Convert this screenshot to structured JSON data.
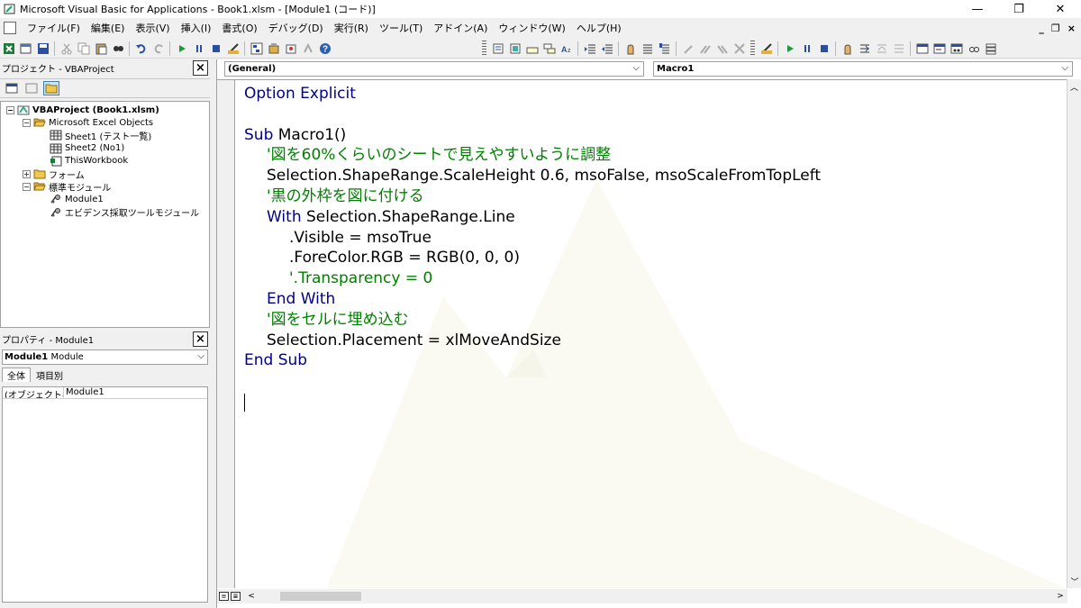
{
  "titlebar": {
    "title": "Microsoft Visual Basic for Applications - Book1.xlsm - [Module1 (コード)]",
    "minimize": "—",
    "restore": "❐",
    "close": "✕"
  },
  "menubar": {
    "items": [
      "ファイル(F)",
      "編集(E)",
      "表示(V)",
      "挿入(I)",
      "書式(O)",
      "デバッグ(D)",
      "実行(R)",
      "ツール(T)",
      "アドイン(A)",
      "ウィンドウ(W)",
      "ヘルプ(H)"
    ],
    "mdi_minimize": "_",
    "mdi_restore": "❐",
    "mdi_close": "×"
  },
  "project_panel": {
    "title": "プロジェクト - VBAProject",
    "close": "×",
    "tree": [
      {
        "label": "VBAProject (Book1.xlsm)",
        "level": 0,
        "expander": "−",
        "icon": "vba-project-icon",
        "bold": true
      },
      {
        "label": "Microsoft Excel Objects",
        "level": 1,
        "expander": "−",
        "icon": "folder-open-icon"
      },
      {
        "label": "Sheet1 (テスト一覧)",
        "level": 2,
        "expander": "",
        "icon": "sheet-icon"
      },
      {
        "label": "Sheet2 (No1)",
        "level": 2,
        "expander": "",
        "icon": "sheet-icon"
      },
      {
        "label": "ThisWorkbook",
        "level": 2,
        "expander": "",
        "icon": "workbook-icon"
      },
      {
        "label": "フォーム",
        "level": 1,
        "expander": "+",
        "icon": "folder-icon"
      },
      {
        "label": "標準モジュール",
        "level": 1,
        "expander": "−",
        "icon": "folder-open-icon"
      },
      {
        "label": "Module1",
        "level": 2,
        "expander": "",
        "icon": "module-icon"
      },
      {
        "label": "エビデンス採取ツールモジュール",
        "level": 2,
        "expander": "",
        "icon": "module-icon"
      }
    ]
  },
  "properties_panel": {
    "title": "プロパティ - Module1",
    "close": "×",
    "object_bold": "Module1",
    "object_type": "Module",
    "tab_all": "全体",
    "tab_category": "項目別",
    "rows": [
      {
        "key": "(オブジェクト名)",
        "value": "Module1"
      }
    ]
  },
  "code_window": {
    "object_combo": "(General)",
    "procedure_combo": "Macro1",
    "lines": [
      {
        "indent": 0,
        "parts": [
          {
            "t": "kw",
            "s": "Option Explicit"
          }
        ]
      },
      {
        "indent": 0,
        "parts": []
      },
      {
        "indent": 0,
        "parts": [
          {
            "t": "kw",
            "s": "Sub "
          },
          {
            "t": "tx",
            "s": "Macro1()"
          }
        ]
      },
      {
        "indent": 1,
        "parts": [
          {
            "t": "cm",
            "s": "'図を60%くらいのシートで見えやすいように調整"
          }
        ]
      },
      {
        "indent": 1,
        "parts": [
          {
            "t": "tx",
            "s": "Selection.ShapeRange.ScaleHeight 0.6, msoFalse, msoScaleFromTopLeft"
          }
        ]
      },
      {
        "indent": 1,
        "parts": [
          {
            "t": "cm",
            "s": "'黒の外枠を図に付ける"
          }
        ]
      },
      {
        "indent": 1,
        "parts": [
          {
            "t": "kw",
            "s": "With "
          },
          {
            "t": "tx",
            "s": "Selection.ShapeRange.Line"
          }
        ]
      },
      {
        "indent": 2,
        "parts": [
          {
            "t": "tx",
            "s": ".Visible = msoTrue"
          }
        ]
      },
      {
        "indent": 2,
        "parts": [
          {
            "t": "tx",
            "s": ".ForeColor.RGB = RGB(0, 0, 0)"
          }
        ]
      },
      {
        "indent": 2,
        "parts": [
          {
            "t": "cm",
            "s": "'.Transparency = 0"
          }
        ]
      },
      {
        "indent": 1,
        "parts": [
          {
            "t": "kw",
            "s": "End With"
          }
        ]
      },
      {
        "indent": 1,
        "parts": [
          {
            "t": "cm",
            "s": "'図をセルに埋め込む"
          }
        ]
      },
      {
        "indent": 1,
        "parts": [
          {
            "t": "tx",
            "s": "Selection.Placement = xlMoveAndSize"
          }
        ]
      },
      {
        "indent": 0,
        "parts": [
          {
            "t": "kw",
            "s": "End Sub"
          }
        ]
      }
    ]
  },
  "colors": {
    "keyword": "#00008b",
    "comment": "#008000",
    "text": "#000000"
  }
}
